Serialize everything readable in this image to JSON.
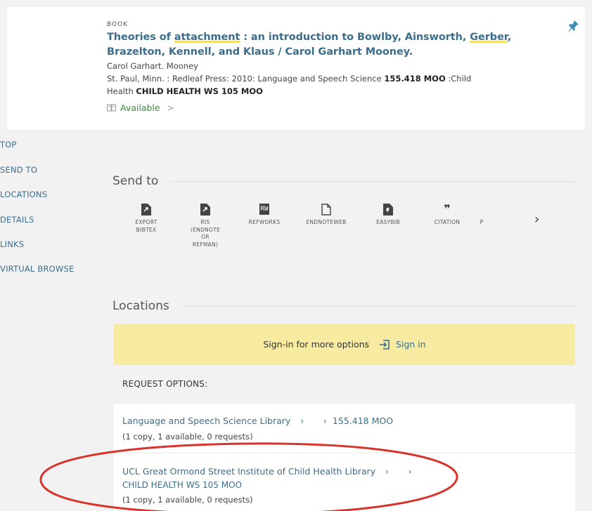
{
  "record": {
    "type": "BOOK",
    "title_parts": [
      "Theories of ",
      "attachment",
      " : an introduction to Bowlby, Ainsworth, ",
      "Gerber",
      ","
    ],
    "title_line2": "Brazelton, Kennell, and Klaus / Carol Garhart Mooney.",
    "author": "Carol Garhart. Mooney",
    "pub_line1_a": "St. Paul, Minn. : Redleaf Press: 2010: Language and Speech Science ",
    "pub_line1_b": "155.418 MOO",
    "pub_line1_c": " :Child",
    "pub_line2_a": "Health ",
    "pub_line2_b": "CHILD HEALTH WS 105 MOO",
    "availability": "Available",
    "availability_color": "#3a8a3a"
  },
  "sidebar": {
    "items": [
      {
        "label": "TOP"
      },
      {
        "label": "SEND TO"
      },
      {
        "label": "LOCATIONS"
      },
      {
        "label": "DETAILS"
      },
      {
        "label": "LINKS"
      },
      {
        "label": "VIRTUAL BROWSE"
      }
    ]
  },
  "send_to": {
    "heading": "Send to",
    "items": [
      {
        "line1": "EXPORT",
        "line2": "BIBTEX",
        "line3": "",
        "line4": "",
        "icon": "export-file-icon"
      },
      {
        "line1": "RIS",
        "line2": "(ENDNOTE",
        "line3": "OR",
        "line4": "REFMAN)",
        "icon": "ris-file-icon"
      },
      {
        "line1": "REFWORKS",
        "line2": "",
        "line3": "",
        "line4": "",
        "icon": "refworks-icon",
        "badge": "RW"
      },
      {
        "line1": "ENDNOTEWEB",
        "line2": "",
        "line3": "",
        "line4": "",
        "icon": "document-icon"
      },
      {
        "line1": "EASYBIB",
        "line2": "",
        "line3": "",
        "line4": "",
        "icon": "easybib-icon"
      },
      {
        "line1": "CITATION",
        "line2": "",
        "line3": "",
        "line4": "",
        "icon": "quote-icon",
        "badge": "❞"
      },
      {
        "line1": "P",
        "line2": "",
        "line3": "",
        "line4": "",
        "icon": ""
      }
    ],
    "next": "›"
  },
  "locations": {
    "heading": "Locations",
    "signin_message": "Sign-in for more options",
    "signin_button": "Sign in",
    "request_options": "REQUEST OPTIONS:",
    "items": [
      {
        "library": "Language and Speech Science Library",
        "arrow1": "›",
        "arrow2": "›",
        "call_number": "155.418 MOO",
        "availability": "(1 copy, 1 available, 0 requests)"
      },
      {
        "library": "UCL Great Ormond Street Institute of Child Health Library",
        "arrow1": "›",
        "arrow2": "›",
        "call_number": "CHILD HEALTH WS 105 MOO",
        "availability": "(1 copy, 1 available, 0 requests)"
      }
    ]
  },
  "colors": {
    "link": "#3c6e8b",
    "signin_bar": "#f6eba0",
    "highlight": "#f4dd6a",
    "annotation_circle": "#d9342b"
  }
}
